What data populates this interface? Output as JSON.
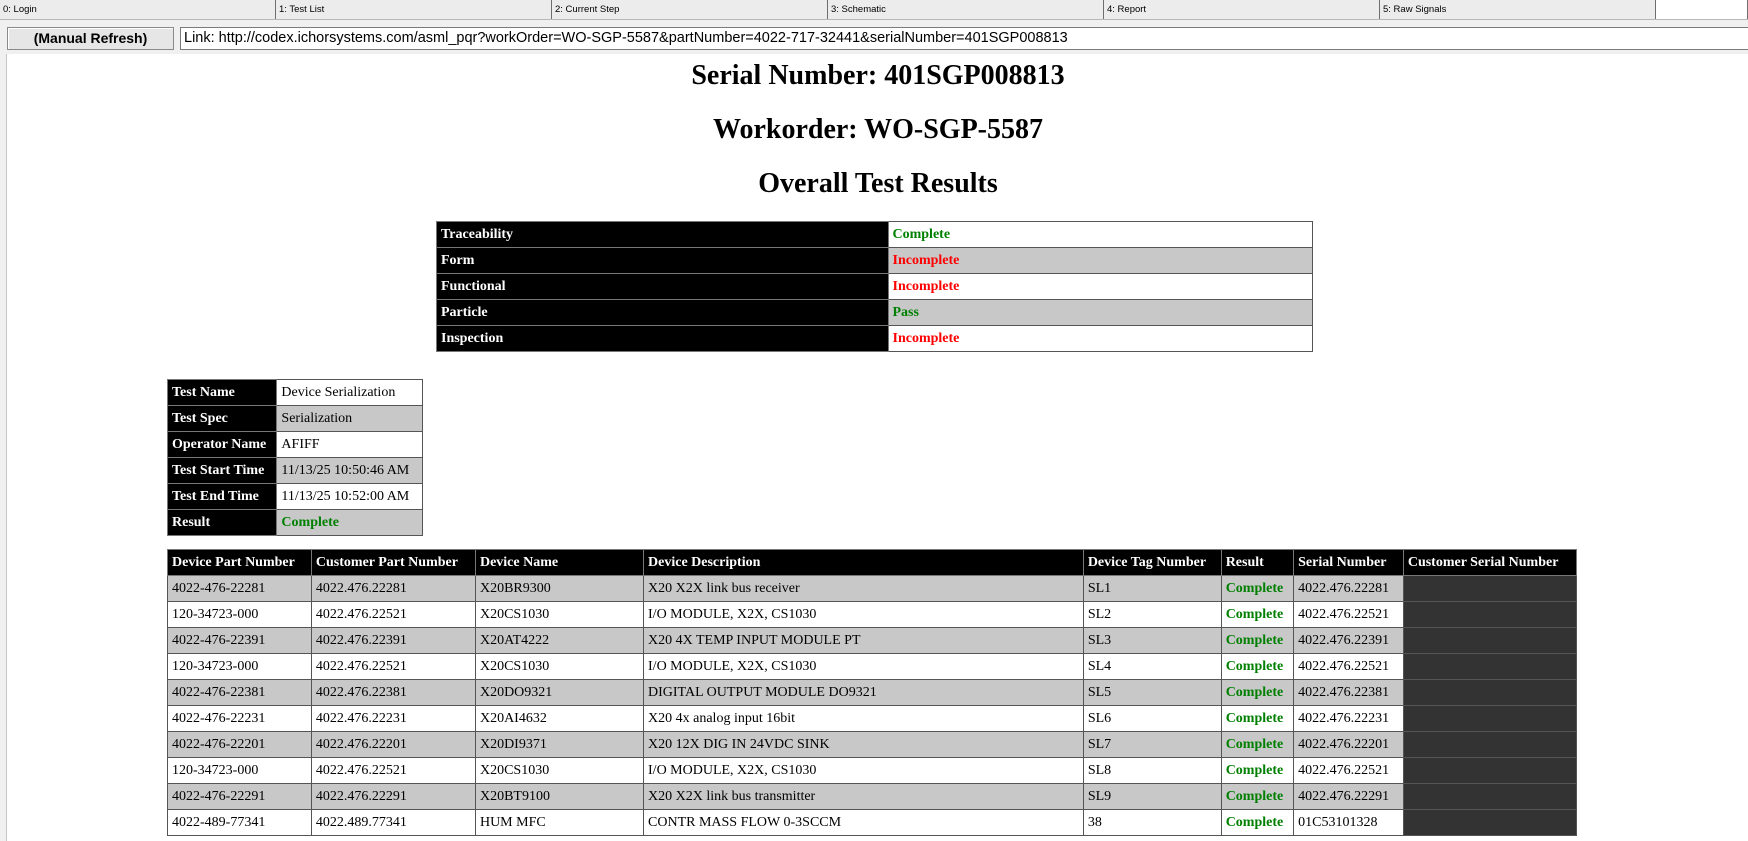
{
  "tabs": [
    {
      "label": "0: Login"
    },
    {
      "label": "1: Test List"
    },
    {
      "label": "2: Current Step"
    },
    {
      "label": "3: Schematic"
    },
    {
      "label": "4: Report"
    },
    {
      "label": "5: Raw Signals"
    }
  ],
  "toolbar": {
    "refresh_label": "(Manual Refresh)",
    "link_text": "Link: http://codex.ichorsystems.com/asml_pqr?workOrder=WO-SGP-5587&partNumber=4022-717-32441&serialNumber=401SGP008813"
  },
  "report": {
    "serial_heading": "Serial Number: 401SGP008813",
    "workorder_heading": "Workorder: WO-SGP-5587",
    "results_heading": "Overall Test Results",
    "summary": [
      {
        "key": "Traceability",
        "value": "Complete"
      },
      {
        "key": "Form",
        "value": "Incomplete"
      },
      {
        "key": "Functional",
        "value": "Incomplete"
      },
      {
        "key": "Particle",
        "value": "Pass"
      },
      {
        "key": "Inspection",
        "value": "Incomplete"
      }
    ],
    "test_info": [
      {
        "key": "Test Name",
        "value": "Device Serialization"
      },
      {
        "key": "Test Spec",
        "value": "Serialization"
      },
      {
        "key": "Operator Name",
        "value": "AFIFF"
      },
      {
        "key": "Test Start Time",
        "value": "11/13/25 10:50:46 AM"
      },
      {
        "key": "Test End Time",
        "value": "11/13/25 10:52:00 AM"
      },
      {
        "key": "Result",
        "value": "Complete"
      }
    ],
    "device_columns": [
      "Device Part Number",
      "Customer Part Number",
      "Device Name",
      "Device Description",
      "Device Tag Number",
      "Result",
      "Serial Number",
      "Customer Serial Number"
    ],
    "devices": [
      [
        "4022-476-22281",
        "4022.476.22281",
        "X20BR9300",
        "X20 X2X link bus receiver",
        "SL1",
        "Complete",
        "4022.476.22281",
        ""
      ],
      [
        "120-34723-000",
        "4022.476.22521",
        "X20CS1030",
        "I/O MODULE, X2X, CS1030",
        "SL2",
        "Complete",
        "4022.476.22521",
        ""
      ],
      [
        "4022-476-22391",
        "4022.476.22391",
        "X20AT4222",
        "X20 4X TEMP INPUT MODULE PT",
        "SL3",
        "Complete",
        "4022.476.22391",
        ""
      ],
      [
        "120-34723-000",
        "4022.476.22521",
        "X20CS1030",
        "I/O MODULE, X2X, CS1030",
        "SL4",
        "Complete",
        "4022.476.22521",
        ""
      ],
      [
        "4022-476-22381",
        "4022.476.22381",
        "X20DO9321",
        "DIGITAL OUTPUT MODULE DO9321",
        "SL5",
        "Complete",
        "4022.476.22381",
        ""
      ],
      [
        "4022-476-22231",
        "4022.476.22231",
        "X20AI4632",
        "X20 4x analog input 16bit",
        "SL6",
        "Complete",
        "4022.476.22231",
        ""
      ],
      [
        "4022-476-22201",
        "4022.476.22201",
        "X20DI9371",
        "X20 12X DIG IN 24VDC SINK",
        "SL7",
        "Complete",
        "4022.476.22201",
        ""
      ],
      [
        "120-34723-000",
        "4022.476.22521",
        "X20CS1030",
        "I/O MODULE, X2X, CS1030",
        "SL8",
        "Complete",
        "4022.476.22521",
        ""
      ],
      [
        "4022-476-22291",
        "4022.476.22291",
        "X20BT9100",
        "X20 X2X link bus transmitter",
        "SL9",
        "Complete",
        "4022.476.22291",
        ""
      ],
      [
        "4022-489-77341",
        "4022.489.77341",
        "HUM MFC",
        "CONTR MASS FLOW 0-3SCCM",
        "38",
        "Complete",
        "01C53101328",
        ""
      ]
    ]
  },
  "colors": {
    "complete": "#008000",
    "incomplete": "#ff0000",
    "header_bg": "#000000",
    "alt_row": "#c8c8c8",
    "customer_serial_cell": "#333333"
  }
}
